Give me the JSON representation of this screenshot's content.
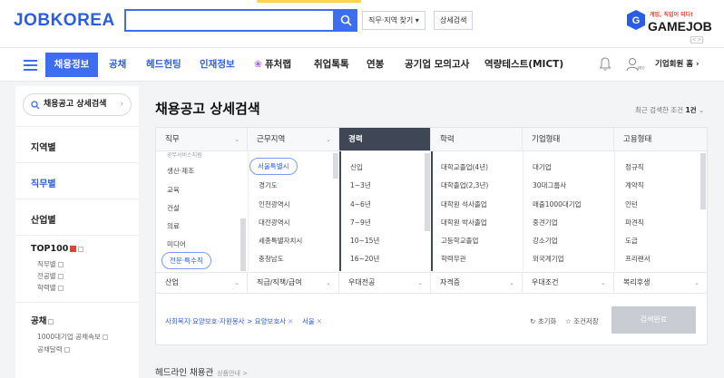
{
  "header": {
    "logo": "JOBKOREA",
    "search_placeholder": "",
    "filter_button": "직무·지역 찾기 ▾",
    "detail_search_button": "상세검색",
    "gamejob_tagline": "게임, 직업이 되다!",
    "gamejob_name": "GAMEJOB",
    "gamejob_nav": "< >"
  },
  "nav": {
    "items": [
      "채용정보",
      "공채",
      "헤드헌팅",
      "인재정보",
      "퓨처랩",
      "취업톡톡",
      "연봉",
      "공기업 모의고사",
      "역량테스트(MICT)"
    ],
    "user_label": "기업회원 홈 ›",
    "user_sub": "MY"
  },
  "sidebar": {
    "search_label": "채용공고 상세검색",
    "sections": [
      {
        "label": "지역별"
      },
      {
        "label": "직무별"
      },
      {
        "label": "산업별"
      }
    ],
    "top100": {
      "label": "TOP100",
      "subs": [
        "직무별",
        "전공별",
        "학력별"
      ]
    },
    "gongchae": {
      "label": "공채",
      "subs": [
        "1000대기업 공채속보",
        "공채달력"
      ]
    }
  },
  "main": {
    "title": "채용공고 상세검색",
    "recent_prefix": "최근 검색한 조건",
    "recent_count": "1건",
    "columns": [
      "직무",
      "근무지역",
      "경력",
      "학력",
      "기업형태",
      "고용형태"
    ],
    "job_options": [
      "공무서비스지원",
      "생산·제조",
      "교육",
      "건설",
      "의료",
      "미디어",
      "전문·특수직"
    ],
    "region_options": [
      "서울특별시",
      "경기도",
      "인천광역시",
      "대전광역시",
      "세종특별자치시",
      "충청남도"
    ],
    "career_options": [
      "신입",
      "1~3년",
      "4~6년",
      "7~9년",
      "10~15년",
      "16~20년"
    ],
    "education_options": [
      "대학교졸업(4년)",
      "대학졸업(2,3년)",
      "대학원 석사졸업",
      "대학원 박사졸업",
      "고등학교졸업",
      "학력무관"
    ],
    "company_options": [
      "대기업",
      "30대그룹사",
      "매출1000대기업",
      "중견기업",
      "강소기업",
      "외국계기업"
    ],
    "employment_options": [
      "정규직",
      "계약직",
      "인턴",
      "파견직",
      "도급",
      "프리랜서"
    ],
    "row2": [
      "산업",
      "직급/직책/급여",
      "우대전공",
      "자격증",
      "우대조건",
      "복리후생"
    ],
    "chip1": "사회복지·요양보호·자원봉사 > 요양보호사",
    "chip2": "서울",
    "reset": "초기화",
    "save": "조건저장",
    "apply": "검색완료",
    "bottom_title": "헤드라인 채용관",
    "bottom_sub": "상품안내 >"
  }
}
